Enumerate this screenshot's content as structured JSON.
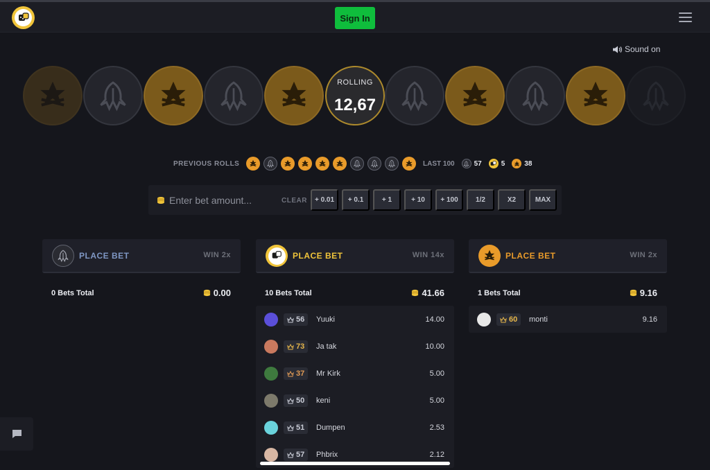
{
  "header": {
    "signin_label": "Sign In"
  },
  "sound": {
    "label": "Sound on"
  },
  "roller": {
    "status": "ROLLING",
    "value": "12,67"
  },
  "previous": {
    "label": "PREVIOUS ROLLS",
    "rolls": [
      "t",
      "ct",
      "t",
      "t",
      "t",
      "t",
      "ct",
      "ct",
      "ct",
      "t"
    ],
    "last_label": "LAST 100",
    "ct_count": "57",
    "bonus_count": "5",
    "t_count": "38"
  },
  "bet": {
    "placeholder": "Enter bet amount...",
    "clear_label": "CLEAR",
    "chips": [
      "+ 0.01",
      "+ 0.1",
      "+ 1",
      "+ 10",
      "+ 100",
      "1/2",
      "X2",
      "MAX"
    ]
  },
  "columns": [
    {
      "team": "ct",
      "place_label": "PLACE BET",
      "win_label": "WIN 2x",
      "total_label": "0 Bets Total",
      "total_amount": "0.00",
      "color": "#7f97c4",
      "rows": []
    },
    {
      "team": "bonus",
      "place_label": "PLACE BET",
      "win_label": "WIN 14x",
      "total_label": "10 Bets Total",
      "total_amount": "41.66",
      "color": "#f0c43a",
      "rows": [
        {
          "level": "56",
          "name": "Yuuki",
          "amount": "14.00",
          "lvl_color": "#c9ccd6",
          "av": "#5b4fd9"
        },
        {
          "level": "73",
          "name": "Ja tak",
          "amount": "10.00",
          "lvl_color": "#e6b64a",
          "av": "#c9795e"
        },
        {
          "level": "37",
          "name": "Mr Kirk",
          "amount": "5.00",
          "lvl_color": "#e09a55",
          "av": "#3e7a3e"
        },
        {
          "level": "50",
          "name": "keni",
          "amount": "5.00",
          "lvl_color": "#c9ccd6",
          "av": "#7d7a6b"
        },
        {
          "level": "51",
          "name": "Dumpen",
          "amount": "2.53",
          "lvl_color": "#c9ccd6",
          "av": "#6ad3dc"
        },
        {
          "level": "57",
          "name": "Phbrix",
          "amount": "2.12",
          "lvl_color": "#c9ccd6",
          "av": "#d8b7a4"
        }
      ]
    },
    {
      "team": "t",
      "place_label": "PLACE BET",
      "win_label": "WIN 2x",
      "total_label": "1 Bets Total",
      "total_amount": "9.16",
      "color": "#e99b2a",
      "rows": [
        {
          "level": "60",
          "name": "monti",
          "amount": "9.16",
          "lvl_color": "#e6b64a",
          "av": "#e8e8e8"
        }
      ]
    }
  ],
  "colors": {
    "accent_green": "#0fbd3c",
    "t_orange": "#e99b2a",
    "ct_blue": "#7f97c4",
    "gold": "#f0c43a"
  },
  "icons": {
    "logo": "dice-logo-icon",
    "sound": "speaker-icon",
    "menu": "hamburger-icon",
    "chat": "chat-icon",
    "coins": "coin-stack-icon"
  }
}
